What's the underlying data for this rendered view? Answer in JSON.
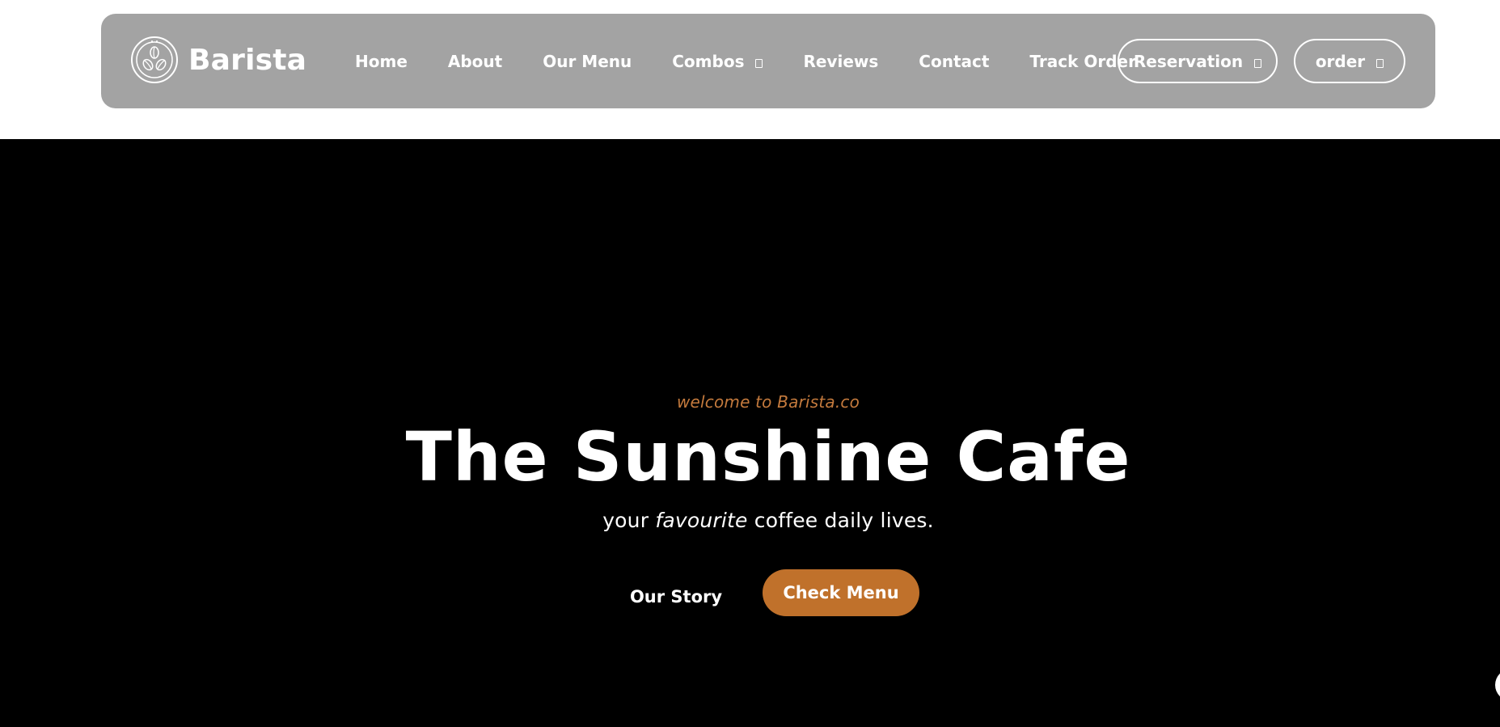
{
  "brand": {
    "name": "Barista",
    "logo_icon": "coffee-beans-icon"
  },
  "nav": {
    "items": [
      {
        "label": "Home"
      },
      {
        "label": "About"
      },
      {
        "label": "Our Menu"
      },
      {
        "label": "Combos",
        "icon": "dropdown-icon"
      },
      {
        "label": "Reviews"
      },
      {
        "label": "Contact"
      },
      {
        "label": "Track Order"
      }
    ],
    "reservation_label": "Reservation",
    "order_label": "order"
  },
  "hero": {
    "eyebrow": "welcome to Barista.co",
    "title": "The Sunshine Cafe",
    "subtitle_before": "your ",
    "subtitle_emphasis": "favourite",
    "subtitle_after": " coffee daily lives.",
    "secondary_link": "Our Story",
    "primary_button": "Check Menu"
  },
  "colors": {
    "navbar_bg": "#a3a3a3",
    "hero_bg": "#000000",
    "accent": "#c0712b",
    "eyebrow": "#c47a3d",
    "text_light": "#ffffff"
  }
}
